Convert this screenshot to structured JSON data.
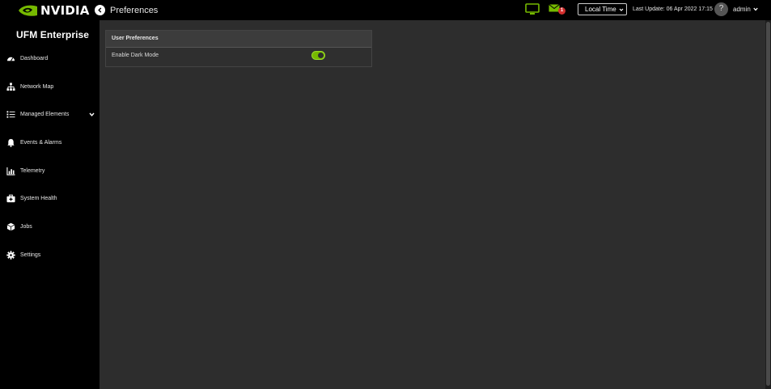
{
  "brand": {
    "logo_text": "NVIDIA",
    "accent": "#76b900"
  },
  "header": {
    "page_title": "Preferences",
    "notification_count": "1",
    "time_select": {
      "value": "Local Time"
    },
    "last_update": "Last Update: 06 Apr 2022 17:15",
    "help_label": "?",
    "user_label": "admin"
  },
  "sidebar": {
    "app_name": "UFM Enterprise",
    "items": [
      {
        "label": "Dashboard",
        "icon": "dashboard-icon"
      },
      {
        "label": "Network Map",
        "icon": "network-map-icon"
      },
      {
        "label": "Managed Elements",
        "icon": "list-icon",
        "expandable": true
      },
      {
        "label": "Events & Alarms",
        "icon": "bell-icon"
      },
      {
        "label": "Telemetry",
        "icon": "chart-icon"
      },
      {
        "label": "System Health",
        "icon": "medical-kit-icon"
      },
      {
        "label": "Jobs",
        "icon": "cube-icon"
      },
      {
        "label": "Settings",
        "icon": "gear-icon"
      }
    ]
  },
  "preferences": {
    "panel_title": "User Preferences",
    "dark_mode_label": "Enable Dark Mode",
    "dark_mode_enabled": true
  }
}
